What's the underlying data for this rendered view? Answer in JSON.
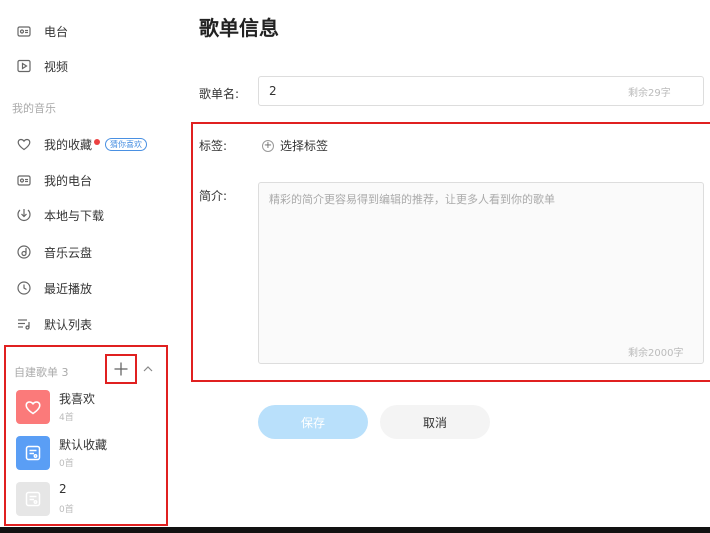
{
  "sidebar": {
    "top_items": [
      {
        "label": "电台",
        "icon": "radio-icon"
      },
      {
        "label": "视频",
        "icon": "video-icon"
      }
    ],
    "section_label": "我的音乐",
    "music_items": [
      {
        "label": "我的收藏",
        "icon": "heart-icon",
        "badge": "猜你喜欢"
      },
      {
        "label": "我的电台",
        "icon": "radio-icon"
      },
      {
        "label": "本地与下载",
        "icon": "download-icon"
      },
      {
        "label": "音乐云盘",
        "icon": "cloud-disk-icon"
      },
      {
        "label": "最近播放",
        "icon": "clock-icon"
      },
      {
        "label": "默认列表",
        "icon": "list-icon"
      }
    ],
    "created": {
      "header": "自建歌单 3",
      "playlists": [
        {
          "name": "我喜欢",
          "count": "4首",
          "cover_color": "#fb7a7a"
        },
        {
          "name": "默认收藏",
          "count": "0首",
          "cover_color": "#5a9ef5"
        },
        {
          "name": "2",
          "count": "0首",
          "cover_color": "#e6e6e6"
        }
      ]
    }
  },
  "main": {
    "title": "歌单信息",
    "name_label": "歌单名:",
    "name_value": "2",
    "name_remaining": "剩余29字",
    "tag_label": "标签:",
    "tag_button": "选择标签",
    "desc_label": "简介:",
    "desc_placeholder": "精彩的简介更容易得到编辑的推荐，让更多人看到你的歌单",
    "desc_remaining": "剩余2000字",
    "save_label": "保存",
    "cancel_label": "取消"
  },
  "colors": {
    "accent": "#e02020",
    "save_bg": "#b9e0fb",
    "badge_blue": "#4a90e2"
  }
}
